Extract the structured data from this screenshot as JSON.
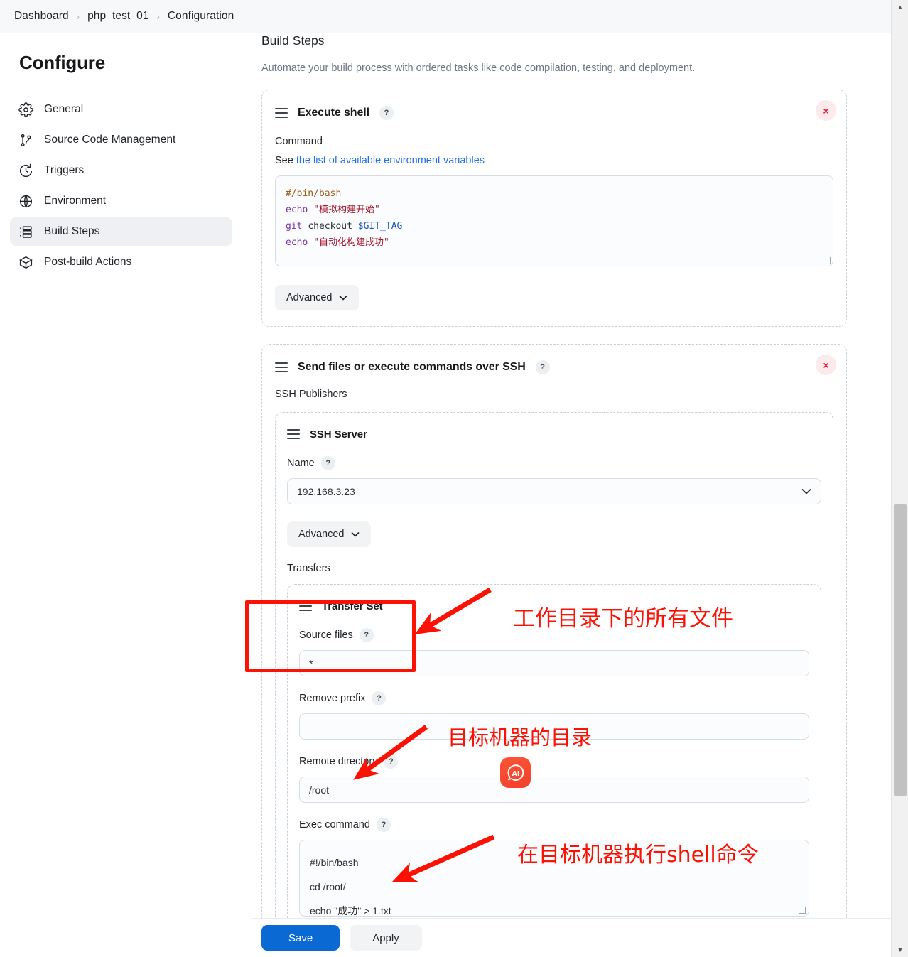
{
  "breadcrumb": {
    "items": [
      "Dashboard",
      "php_test_01",
      "Configuration"
    ],
    "separator": "›"
  },
  "sidebar": {
    "title": "Configure",
    "items": [
      {
        "label": "General",
        "icon": "gear-icon",
        "active": false
      },
      {
        "label": "Source Code Management",
        "icon": "git-branch-icon",
        "active": false
      },
      {
        "label": "Triggers",
        "icon": "clock-icon",
        "active": false
      },
      {
        "label": "Environment",
        "icon": "globe-icon",
        "active": false
      },
      {
        "label": "Build Steps",
        "icon": "list-icon",
        "active": true
      },
      {
        "label": "Post-build Actions",
        "icon": "box-icon",
        "active": false
      }
    ]
  },
  "main": {
    "section_title": "Build Steps",
    "section_subtitle": "Automate your build process with ordered tasks like code compilation, testing, and deployment.",
    "execute_shell": {
      "title": "Execute shell",
      "help": "?",
      "close": "×",
      "command_label": "Command",
      "see_text": "See ",
      "see_link": "the list of available environment variables",
      "code": {
        "line1_comment": "#/bin/bash",
        "line2_kw": "echo",
        "line2_str": "\"模拟构建开始\"",
        "line3_kw": "git",
        "line3_plain": "checkout",
        "line3_var": "$GIT_TAG",
        "line4_kw": "echo",
        "line4_str": "\"自动化构建成功\""
      },
      "advanced_label": "Advanced",
      "advanced_chevron": "⌄"
    },
    "ssh": {
      "title": "Send files or execute commands over SSH",
      "help": "?",
      "close": "×",
      "publishers_label": "SSH Publishers",
      "server": {
        "title": "SSH Server",
        "name_label": "Name",
        "name_help": "?",
        "name_value": "192.168.3.23",
        "chevron": "∨",
        "advanced_label": "Advanced",
        "advanced_chevron": "⌄",
        "transfers_label": "Transfers",
        "transfer_set": {
          "title": "Transfer Set",
          "source_files_label": "Source files",
          "source_files_help": "?",
          "source_files_value": "*",
          "remove_prefix_label": "Remove prefix",
          "remove_prefix_help": "?",
          "remove_prefix_value": "",
          "remote_directory_label": "Remote directory",
          "remote_directory_help": "?",
          "remote_directory_value": "/root",
          "exec_command_label": "Exec command",
          "exec_command_help": "?",
          "exec_command_line1": "#!/bin/bash",
          "exec_command_line2": "cd /root/",
          "exec_command_line3": "echo \"成功\" > 1.txt"
        }
      }
    }
  },
  "footer": {
    "save_label": "Save",
    "apply_label": "Apply"
  },
  "annotations": {
    "note1": "工作目录下的所有文件",
    "note2": "目标机器的目录",
    "note3": "在目标机器执行shell命令",
    "ai_badge": "AI"
  },
  "scrollbar": {
    "up": "▲",
    "down": "▼"
  },
  "colors": {
    "accent": "#0b69d4",
    "annotation": "#fb1205",
    "link": "#1f6feb",
    "ai_badge": "#f4402a"
  }
}
